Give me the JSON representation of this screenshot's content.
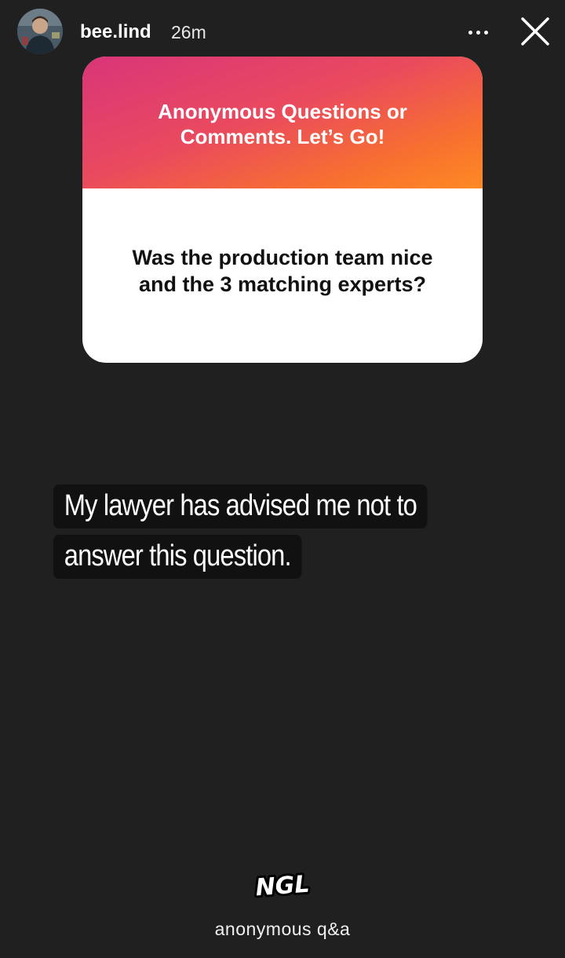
{
  "header": {
    "username": "bee.lind",
    "time_ago": "26m",
    "more_icon": "ellipsis-icon",
    "close_icon": "close-icon"
  },
  "question_card": {
    "prompt": "Anonymous Questions or Comments. Let’s Go!",
    "question": "Was the production team nice and the 3 matching experts?",
    "gradient_colors": [
      "#d9357a",
      "#f8702f"
    ]
  },
  "answer": {
    "lines": [
      "My lawyer has advised me not to",
      "answer this question."
    ]
  },
  "footer": {
    "logo_text": "NGL",
    "caption": "anonymous q&a"
  }
}
